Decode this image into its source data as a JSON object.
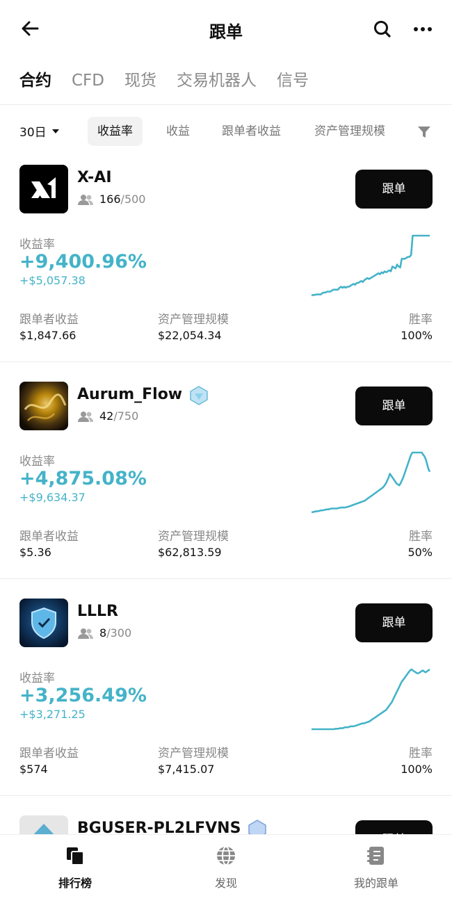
{
  "header": {
    "title": "跟单"
  },
  "main_tabs": [
    {
      "label": "合约",
      "active": true
    },
    {
      "label": "CFD",
      "active": false
    },
    {
      "label": "现货",
      "active": false
    },
    {
      "label": "交易机器人",
      "active": false
    },
    {
      "label": "信号",
      "active": false
    }
  ],
  "filters": {
    "period": "30日",
    "sort_chips": [
      "收益率",
      "收益",
      "跟单者收益",
      "资产管理规模"
    ],
    "active_chip": "收益率"
  },
  "common": {
    "follow_label": "跟单",
    "roi_label": "收益率",
    "follower_pnl_label": "跟单者收益",
    "aum_label": "资产管理规模",
    "winrate_label": "胜率"
  },
  "traders": [
    {
      "name": "X-AI",
      "followers": "166",
      "capacity": "/500",
      "roi": "+9,400.96%",
      "pnl": "+$5,057.38",
      "follower_pnl": "$1,847.66",
      "aum": "$22,054.34",
      "win_rate": "100%",
      "badge": false,
      "avatar": "x-ai-logo",
      "sparkline": [
        0,
        0.5,
        0.5,
        1,
        1,
        1,
        1,
        2.5,
        3,
        3,
        4,
        4,
        4,
        5,
        6,
        6,
        6,
        6,
        8,
        9,
        8,
        9,
        8,
        9,
        9,
        10,
        11,
        12,
        11,
        13,
        13,
        14,
        15,
        14,
        16,
        17,
        18,
        17,
        18,
        19,
        20,
        21,
        22,
        23,
        22,
        24,
        23,
        25,
        24,
        25,
        26,
        25,
        30,
        29,
        28,
        32,
        30,
        29,
        38,
        38,
        38,
        39,
        40,
        40,
        42,
        62,
        62,
        62,
        62,
        62,
        62,
        62,
        62,
        62,
        62,
        62,
        62
      ]
    },
    {
      "name": "Aurum_Flow",
      "followers": "42",
      "capacity": "/750",
      "roi": "+4,875.08%",
      "pnl": "+$9,634.37",
      "follower_pnl": "$5.36",
      "aum": "$62,813.59",
      "win_rate": "50%",
      "badge": true,
      "avatar": "gold-abstract-avatar",
      "sparkline": [
        0,
        0.3,
        0.6,
        1,
        1,
        1.2,
        1.5,
        2,
        2,
        2.2,
        2.5,
        3,
        3,
        3.2,
        3.5,
        4,
        4,
        4,
        4,
        4,
        4.3,
        4.6,
        5,
        5,
        5,
        5,
        5.3,
        5.6,
        6,
        6.5,
        7,
        7.5,
        8,
        8.5,
        9,
        9.5,
        10,
        10.5,
        11,
        11.5,
        12,
        13,
        14,
        15,
        16,
        17,
        18,
        19,
        20,
        21,
        22,
        23,
        24,
        25,
        26,
        28,
        30,
        33,
        36,
        40,
        38,
        36,
        34,
        32,
        30,
        29,
        28,
        30,
        33,
        36,
        40,
        44,
        48,
        52,
        56,
        60,
        62,
        62,
        62,
        62,
        62,
        62,
        62,
        62,
        60,
        58,
        55,
        50,
        45,
        42
      ]
    },
    {
      "name": "LLLR",
      "followers": "8",
      "capacity": "/300",
      "roi": "+3,256.49%",
      "pnl": "+$3,271.25",
      "follower_pnl": "$574",
      "aum": "$7,415.07",
      "win_rate": "100%",
      "badge": false,
      "avatar": "shield-avatar",
      "sparkline": [
        0,
        0,
        0,
        0,
        0,
        0,
        0,
        0,
        0,
        0,
        0,
        0,
        0,
        0,
        0,
        0,
        0,
        0.5,
        0.5,
        0.5,
        1,
        1,
        1,
        1.5,
        2,
        2,
        2,
        2.5,
        3,
        3,
        3,
        3.5,
        4,
        4.5,
        5,
        5.5,
        6,
        6,
        6.5,
        7,
        7.5,
        8,
        9,
        10,
        11,
        12,
        13,
        14,
        15,
        16,
        17,
        18,
        19,
        20,
        22,
        24,
        26,
        28,
        31,
        34,
        37,
        40,
        43,
        46,
        49,
        51,
        53,
        55,
        57,
        59,
        61,
        62,
        61,
        60,
        59,
        58,
        58,
        59,
        60,
        61,
        60,
        59,
        60,
        61,
        62
      ]
    },
    {
      "name": "BGUSER-PL2LFVNS",
      "badge": true,
      "avatar": "diamond-avatar"
    }
  ],
  "bottom_nav": [
    {
      "label": "排行榜",
      "icon": "leaderboard-icon",
      "active": true
    },
    {
      "label": "发现",
      "icon": "globe-icon",
      "active": false
    },
    {
      "label": "我的跟单",
      "icon": "notebook-icon",
      "active": false
    }
  ],
  "colors": {
    "accent": "#44b3c8",
    "button": "#0b0b0b"
  }
}
